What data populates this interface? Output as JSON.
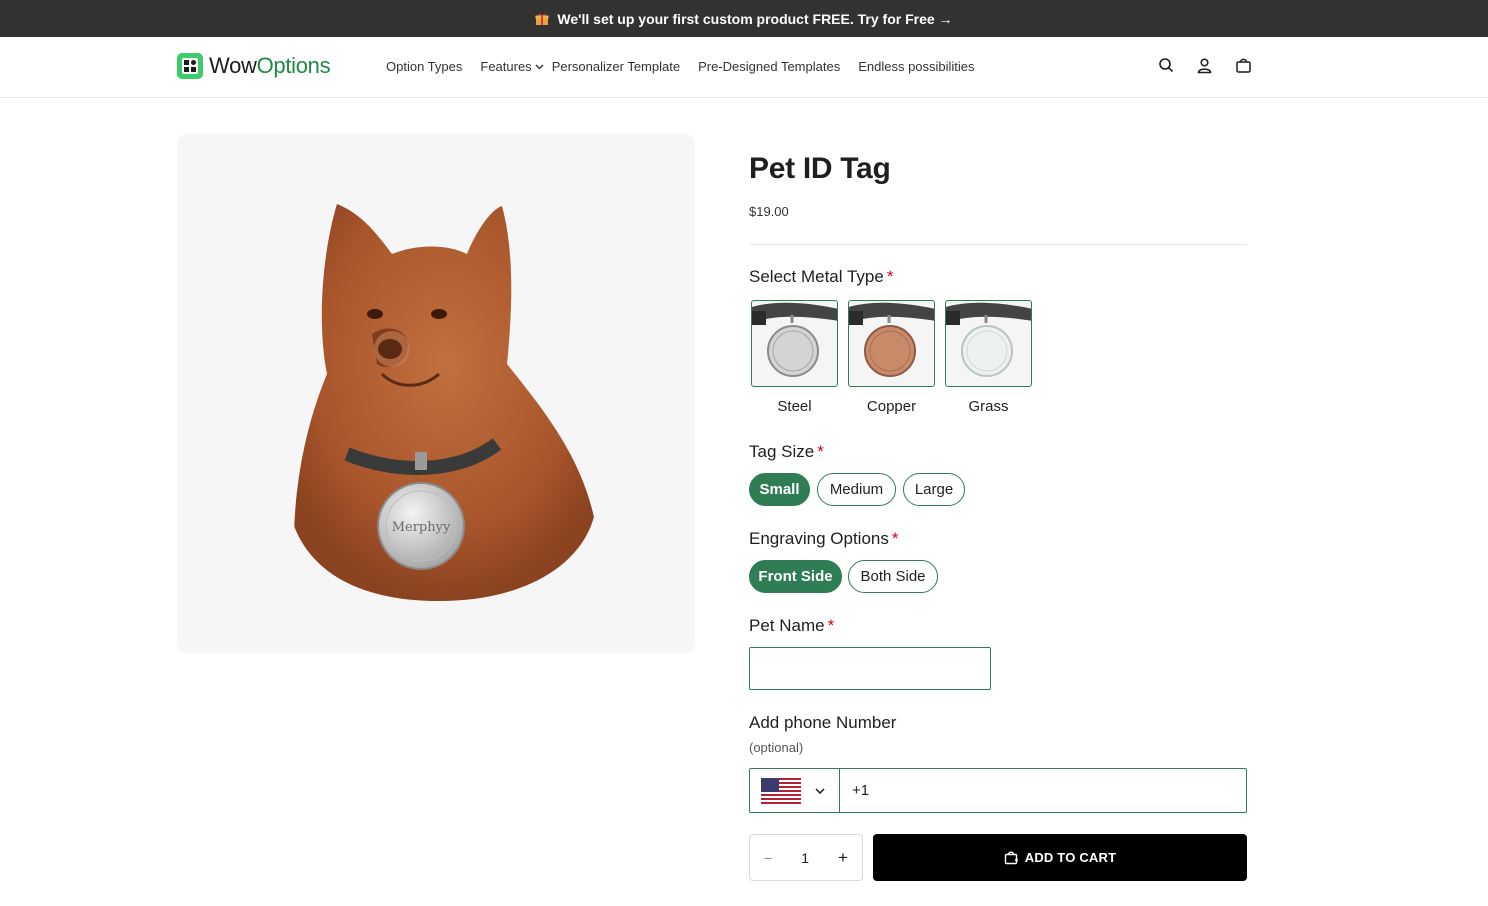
{
  "announcement": {
    "text": "We'll set up your first custom product FREE. Try for Free →",
    "icon": "gift-icon"
  },
  "brand": {
    "name_part1": "Wow",
    "name_part2": "Options",
    "color": "#1d8a3f"
  },
  "nav": {
    "items": [
      {
        "label": "Option Types"
      },
      {
        "label": "Features"
      },
      {
        "label": "Personalizer Template"
      },
      {
        "label": "Pre-Designed Templates"
      },
      {
        "label": "Endless possibilities"
      }
    ]
  },
  "header_icons": [
    "search-icon",
    "account-icon",
    "cart-bag-icon"
  ],
  "product": {
    "title": "Pet ID Tag",
    "price": "$19.00",
    "image_tag_text": "Merphyy"
  },
  "metal_type": {
    "label": "Select Metal Type",
    "required": "*",
    "options": [
      {
        "label": "Steel",
        "tag_color": "#cfcfcf"
      },
      {
        "label": "Copper",
        "tag_color": "#c98a6a"
      },
      {
        "label": "Grass",
        "tag_color": "#e8ecec"
      }
    ]
  },
  "tag_size": {
    "label": "Tag Size",
    "required": "*",
    "options": [
      "Small",
      "Medium",
      "Large"
    ],
    "selected": "Small"
  },
  "engraving": {
    "label": "Engraving Options",
    "required": "*",
    "options": [
      "Front Side",
      "Both Side"
    ],
    "selected": "Front Side"
  },
  "pet_name": {
    "label": "Pet Name",
    "required": "*",
    "value": ""
  },
  "phone": {
    "label": "Add phone Number",
    "note": "(optional)",
    "country": "US",
    "dial_code": "+1"
  },
  "quantity": {
    "minus": "−",
    "value": "1",
    "plus": "+"
  },
  "cart": {
    "label": "ADD TO CART"
  },
  "colors": {
    "accent": "#2e7d55",
    "required": "#d0021b",
    "announcement_bg": "#323232"
  }
}
